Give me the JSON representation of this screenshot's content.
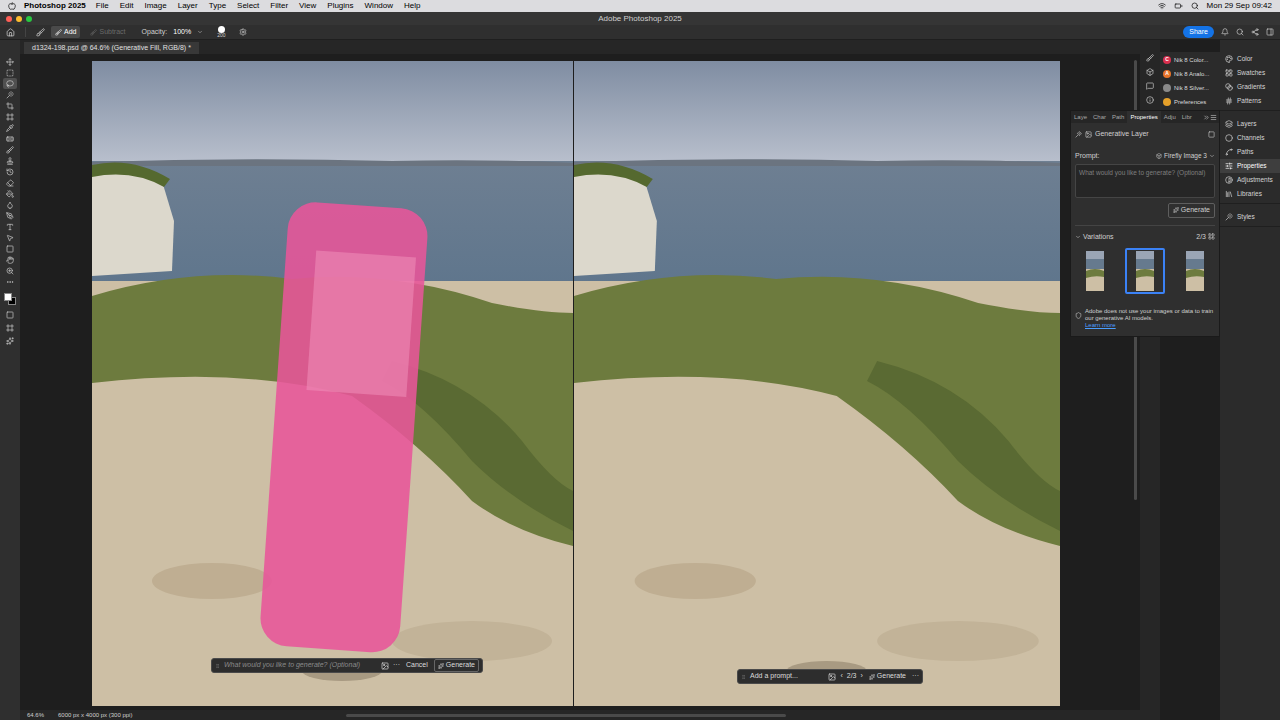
{
  "menu_bar": {
    "app": "Photoshop 2025",
    "items": [
      "File",
      "Edit",
      "Image",
      "Layer",
      "Type",
      "Select",
      "Filter",
      "View",
      "Plugins",
      "Window",
      "Help"
    ],
    "clock": "Mon 29 Sep 09:42"
  },
  "window": {
    "title": "Adobe Photoshop 2025"
  },
  "options_bar": {
    "modes": [
      {
        "label": "Add",
        "selected": true,
        "disabled": false
      },
      {
        "label": "Subtract",
        "selected": false,
        "disabled": true
      }
    ],
    "opacity_label": "Opacity:",
    "opacity": "100%",
    "brush_size": "200",
    "share": "Share"
  },
  "tools": [
    {
      "selected": false
    },
    {
      "selected": false
    },
    {
      "selected": true
    },
    {
      "selected": false
    },
    {
      "selected": false
    },
    {
      "selected": false
    },
    {
      "selected": false
    },
    {
      "selected": false
    },
    {
      "selected": false
    },
    {
      "selected": false
    },
    {
      "selected": false
    },
    {
      "selected": false
    },
    {
      "selected": false
    },
    {
      "selected": false
    },
    {
      "selected": false
    },
    {
      "selected": false
    },
    {
      "selected": false
    },
    {
      "selected": false
    },
    {
      "selected": false
    },
    {
      "selected": false
    },
    {
      "selected": false
    }
  ],
  "document_tab": {
    "title": "d1324-198.psd @ 64.6% (Generative Fill, RGB/8) *"
  },
  "canvas": {
    "before": {
      "masked": true
    },
    "after": {
      "masked": false
    }
  },
  "selection_bar": {
    "placeholder": "What would you like to generate? (Optional)",
    "more": "···",
    "cancel": "Cancel",
    "generate": "Generate"
  },
  "variation_bar": {
    "prompt": "Add a prompt...",
    "previous": "‹",
    "count": "2/3",
    "next": "›",
    "generate": "Generate",
    "more": "···"
  },
  "plugins": [
    {
      "label": "Nik 8 Color...",
      "glyph": "C",
      "color": "#d9304f"
    },
    {
      "label": "Nik 8 Analo...",
      "glyph": "A",
      "color": "#e8742a"
    },
    {
      "label": "Nik 8 Silver...",
      "glyph": "",
      "color": "#8a8a8a"
    },
    {
      "label": "Preferences",
      "glyph": "",
      "color": "#e6a12a"
    }
  ],
  "properties_panel": {
    "tabs": [
      {
        "label": "Laye",
        "selected": false
      },
      {
        "label": "Char",
        "selected": false
      },
      {
        "label": "Path",
        "selected": false
      },
      {
        "label": "Properties",
        "selected": true
      },
      {
        "label": "Adju",
        "selected": false
      },
      {
        "label": "Libr",
        "selected": false
      }
    ],
    "layer_type": "Generative Layer",
    "prompt_label": "Prompt:",
    "model": "Firefly Image 3",
    "placeholder": "What would you like to generate? (Optional)",
    "generate": "Generate",
    "variations_label": "Variations",
    "variations_count": "2/3",
    "variations": [
      {
        "selected": false
      },
      {
        "selected": true
      },
      {
        "selected": false
      }
    ],
    "notice": "Adobe does not use your images or data to train our generative AI models.",
    "learn_more": "Learn more"
  },
  "dock": [
    [
      {
        "label": "Color",
        "selected": false
      },
      {
        "label": "Swatches",
        "selected": false
      },
      {
        "label": "Gradients",
        "selected": false
      },
      {
        "label": "Patterns",
        "selected": false
      }
    ],
    [
      {
        "label": "Layers",
        "selected": false
      },
      {
        "label": "Channels",
        "selected": false
      },
      {
        "label": "Paths",
        "selected": false
      },
      {
        "label": "Properties",
        "selected": true
      },
      {
        "label": "Adjustments",
        "selected": false
      },
      {
        "label": "Libraries",
        "selected": false
      }
    ],
    [
      {
        "label": "Styles",
        "selected": false
      }
    ]
  ],
  "status_bar": {
    "zoom": "64.6%",
    "document_info": "6000 px x 4000 px (300 ppi)"
  }
}
